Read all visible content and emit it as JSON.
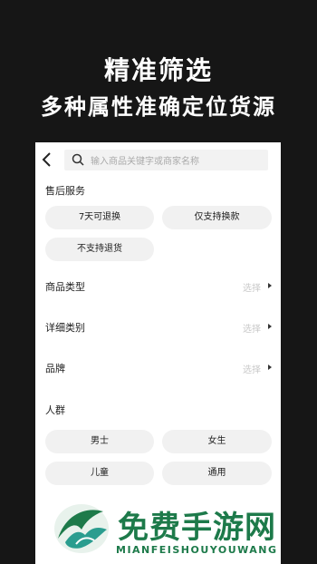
{
  "promo": {
    "line1": "精准筛选",
    "line2": "多种属性准确定位货源"
  },
  "search": {
    "placeholder": "输入商品关键字或商家名称"
  },
  "after_sales": {
    "label": "售后服务",
    "options": [
      "7天可退换",
      "仅支持换款",
      "不支持退货"
    ]
  },
  "filters": [
    {
      "label": "商品类型",
      "value": "选择"
    },
    {
      "label": "详细类别",
      "value": "选择"
    },
    {
      "label": "品牌",
      "value": "选择"
    }
  ],
  "audience": {
    "label": "人群",
    "options": [
      "男士",
      "女生",
      "儿童",
      "通用"
    ]
  },
  "watermark": {
    "title": "免费手游网",
    "subtitle": "MIANFEISHOUYOUWANG"
  }
}
